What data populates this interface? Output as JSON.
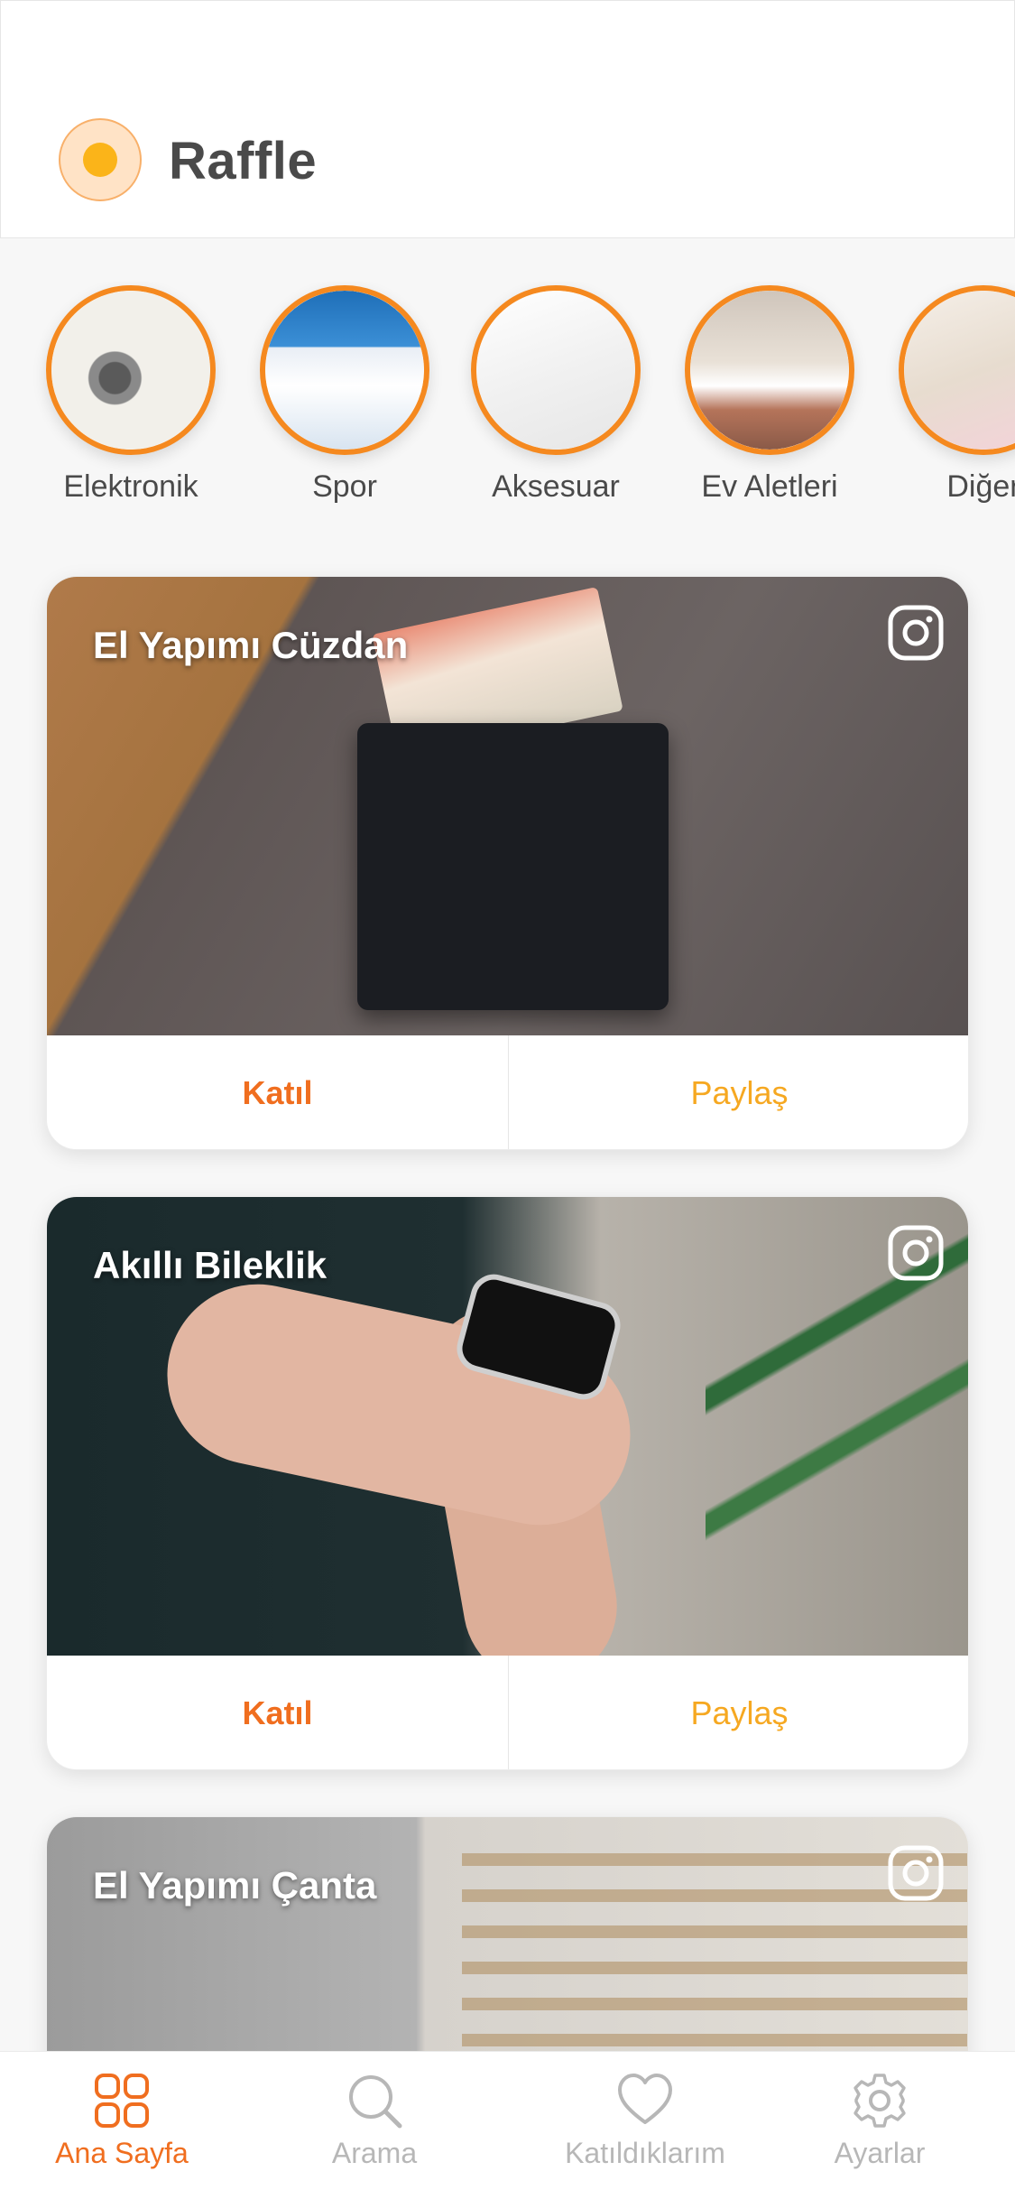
{
  "header": {
    "title": "Raffle",
    "logo_icon": "circle-logo-icon"
  },
  "categories": [
    {
      "label": "Elektronik"
    },
    {
      "label": "Spor"
    },
    {
      "label": "Aksesuar"
    },
    {
      "label": "Ev Aletleri"
    },
    {
      "label": "Diğer"
    }
  ],
  "cards": [
    {
      "title": "El Yapımı Cüzdan",
      "join_label": "Katıl",
      "share_label": "Paylaş",
      "social_icon": "instagram-icon"
    },
    {
      "title": "Akıllı Bileklik",
      "join_label": "Katıl",
      "share_label": "Paylaş",
      "social_icon": "instagram-icon"
    },
    {
      "title": "El Yapımı Çanta",
      "social_icon": "instagram-icon"
    }
  ],
  "tabbar": {
    "items": [
      {
        "label": "Ana Sayfa",
        "icon": "grid-icon",
        "active": true
      },
      {
        "label": "Arama",
        "icon": "search-icon",
        "active": false
      },
      {
        "label": "Katıldıklarım",
        "icon": "heart-icon",
        "active": false
      },
      {
        "label": "Ayarlar",
        "icon": "gear-icon",
        "active": false
      }
    ]
  },
  "colors": {
    "accent": "#f06e1f",
    "share": "#f6a821",
    "ring": "#f5891f",
    "logo_dot": "#fbb419"
  }
}
